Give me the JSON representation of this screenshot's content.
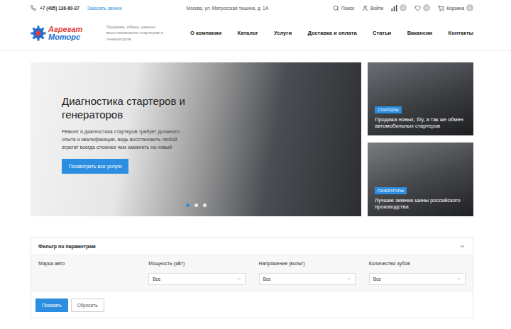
{
  "topbar": {
    "phone": "+7 (495) 136-60-37",
    "callback": "Заказать звонок",
    "address": "Москва, ул. Матросская тишина, д. 1А",
    "search": "Поиск",
    "login": "Войти",
    "compare_count": "0",
    "favorites_count": "0",
    "cart": "Корзина",
    "cart_count": "0"
  },
  "header": {
    "logo": {
      "line1": "Агрегат",
      "line2": "Моторс"
    },
    "tagline": "Продажа, обмен, ремонт, восстановление стартеров и генераторов",
    "nav": [
      {
        "label": "О компании"
      },
      {
        "label": "Каталог"
      },
      {
        "label": "Услуги"
      },
      {
        "label": "Доставка и оплата"
      },
      {
        "label": "Статьи"
      },
      {
        "label": "Вакансии"
      },
      {
        "label": "Контакты"
      }
    ]
  },
  "hero": {
    "title": "Диагностика стартеров и генераторов",
    "text": "Ремонт и диагностика стартеров требует должного опыта и квалификации, ведь восстановить любой агрегат всегда сложнее чем заменить на новый",
    "button": "Посмотреть все услуги",
    "slides": [
      {
        "selected": true
      },
      {
        "selected": false
      },
      {
        "selected": false
      }
    ]
  },
  "side_cards": [
    {
      "tag": "СТАРТЕРЫ",
      "title": "Продажа новых, б/у, а так же обмен автомобильных стартеров"
    },
    {
      "tag": "ГЕНЕРАТОРЫ",
      "title": "Лучшие зимние шины российского производства"
    }
  ],
  "filter": {
    "title": "Фильтр по параметрам",
    "expanded": true,
    "fields": [
      {
        "label": "Марка авто",
        "kind": "empty"
      },
      {
        "label": "Мощность (кВт)",
        "kind": "select",
        "value": "Все"
      },
      {
        "label": "Напряжение (вольт)",
        "kind": "select",
        "value": "Все"
      },
      {
        "label": "Количество зубов",
        "kind": "select",
        "value": "Все"
      }
    ],
    "buttons": [
      {
        "label": "Показать",
        "kind": "primary"
      },
      {
        "label": "Сбросить",
        "kind": "secondary"
      }
    ]
  }
}
